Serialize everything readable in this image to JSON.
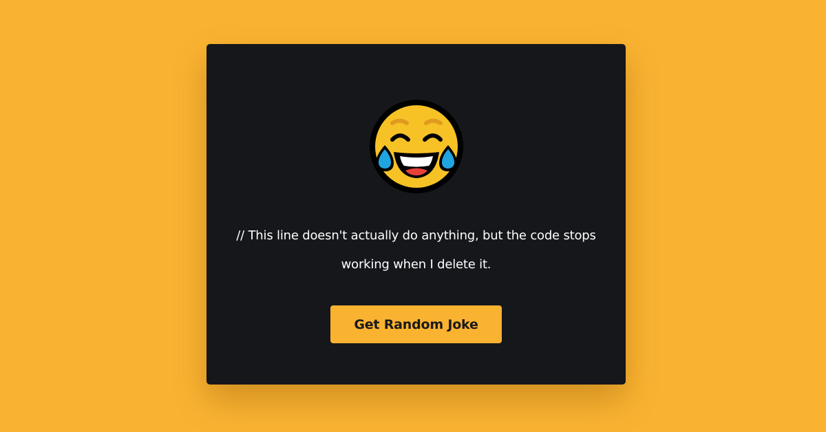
{
  "app": {
    "background_color": "#FAB331",
    "card_color": "#15171B"
  },
  "emoji": {
    "icon": "face-with-tears-of-joy-icon"
  },
  "joke": {
    "text": "// This line doesn't actually do anything, but the code stops working when I delete it."
  },
  "button": {
    "label": "Get Random Joke",
    "color": "#FAB331"
  }
}
